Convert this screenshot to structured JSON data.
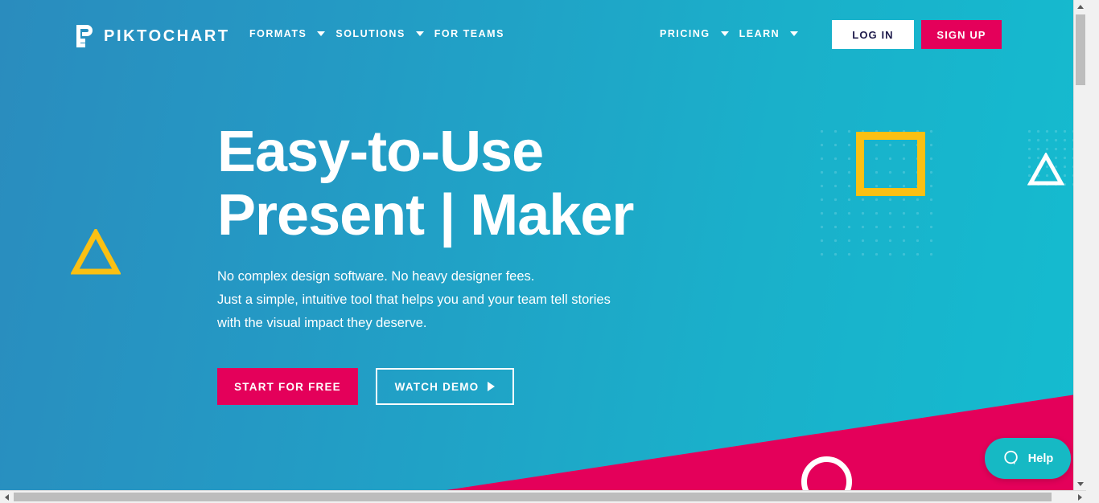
{
  "brand": {
    "name": "PIKTOCHART",
    "logo_icon": "piktochart-p-logo-icon"
  },
  "nav": {
    "left_items": [
      {
        "label": "FORMATS",
        "has_caret": true
      },
      {
        "label": "SOLUTIONS",
        "has_caret": true
      },
      {
        "label": "FOR TEAMS",
        "has_caret": false
      }
    ],
    "right_items": [
      {
        "label": "PRICING",
        "has_caret": true
      },
      {
        "label": "LEARN",
        "has_caret": true
      }
    ],
    "login_label": "LOG IN",
    "signup_label": "SIGN UP"
  },
  "hero": {
    "title": "Easy-to-Use\nPresent | Maker",
    "subtitle": "No complex design software. No heavy designer fees.\nJust a simple, intuitive tool that helps you and your team tell stories\nwith the visual impact they deserve.",
    "cta_primary": "START FOR FREE",
    "cta_secondary": "WATCH DEMO"
  },
  "help": {
    "label": "Help",
    "icon": "chat-bubble-icon"
  },
  "colors": {
    "bg_left": "#2a8cbe",
    "bg_right": "#14bcd0",
    "accent_pink": "#e4005a",
    "accent_yellow": "#fbc013",
    "help_teal": "#16b9c4",
    "login_text": "#1e1b4b",
    "white": "#ffffff"
  },
  "decor": {
    "square_icon": "yellow-square-outline",
    "triangle_left_icon": "yellow-triangle-outline",
    "triangle_right_icon": "white-triangle-outline",
    "circle_icon": "white-circle-outline",
    "dots_icon": "dot-grid-pattern",
    "wedge_icon": "pink-diagonal-wedge"
  },
  "scrollbars": {
    "up_arrow_icon": "arrow-up-icon",
    "down_arrow_icon": "arrow-down-icon",
    "left_arrow_icon": "arrow-left-icon",
    "right_arrow_icon": "arrow-right-icon"
  }
}
